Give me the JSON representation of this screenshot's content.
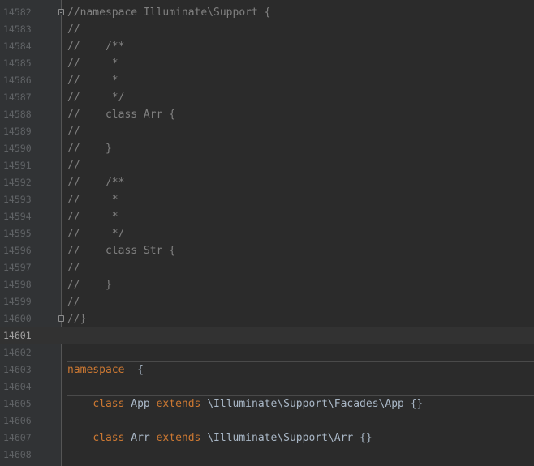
{
  "editor": {
    "comment_lines": [
      {
        "num": "14582",
        "text": "//namespace Illuminate\\Support {",
        "fold": true
      },
      {
        "num": "14583",
        "text": "//"
      },
      {
        "num": "14584",
        "text": "//    /**"
      },
      {
        "num": "14585",
        "text": "//     *"
      },
      {
        "num": "14586",
        "text": "//     *"
      },
      {
        "num": "14587",
        "text": "//     */"
      },
      {
        "num": "14588",
        "text": "//    class Arr {"
      },
      {
        "num": "14589",
        "text": "//"
      },
      {
        "num": "14590",
        "text": "//    }"
      },
      {
        "num": "14591",
        "text": "//"
      },
      {
        "num": "14592",
        "text": "//    /**"
      },
      {
        "num": "14593",
        "text": "//     *"
      },
      {
        "num": "14594",
        "text": "//     *"
      },
      {
        "num": "14595",
        "text": "//     */"
      },
      {
        "num": "14596",
        "text": "//    class Str {"
      },
      {
        "num": "14597",
        "text": "//"
      },
      {
        "num": "14598",
        "text": "//    }"
      },
      {
        "num": "14599",
        "text": "//"
      },
      {
        "num": "14600",
        "text": "//}",
        "fold": true
      }
    ],
    "current_line_num": "14601",
    "empty_lines": {
      "l14602": "14602",
      "l14604": "14604",
      "l14606": "14606",
      "l14608": "14608"
    },
    "namespace_line": {
      "num": "14603",
      "keyword": "namespace",
      "rest": "  {"
    },
    "class_app_line": {
      "num": "14605",
      "indent": "    ",
      "kw_class": "class",
      "name": "App",
      "kw_extends": "extends",
      "parent": "\\Illuminate\\Support\\Facades\\App {}"
    },
    "class_arr_line": {
      "num": "14607",
      "indent": "    ",
      "kw_class": "class",
      "name": "Arr",
      "kw_extends": "extends",
      "parent": "\\Illuminate\\Support\\Arr {}"
    }
  },
  "colors": {
    "background": "#2b2b2b",
    "gutter": "#313335",
    "comment": "#808080",
    "keyword": "#cc7832",
    "identifier": "#a9b7c6",
    "line_number": "#606366"
  }
}
